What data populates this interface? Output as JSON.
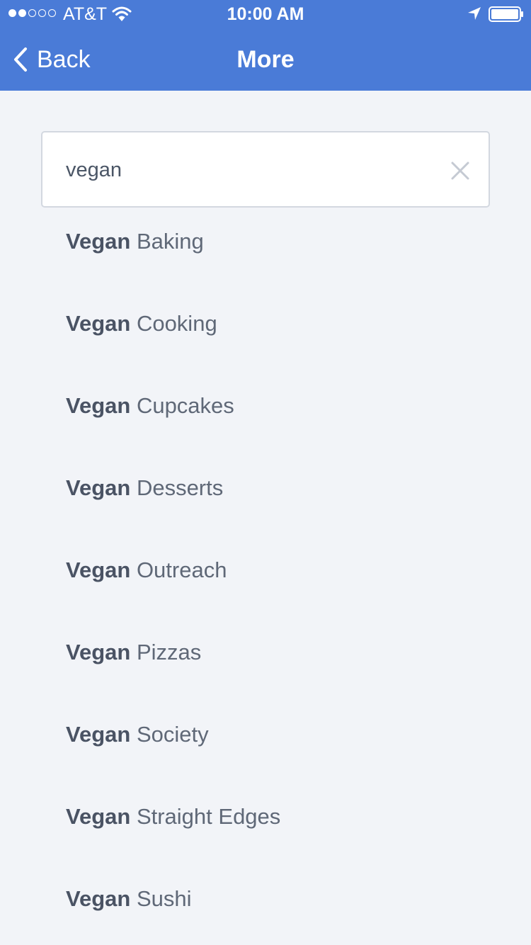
{
  "status_bar": {
    "signal_dots": [
      true,
      true,
      false,
      false,
      false
    ],
    "carrier": "AT&T",
    "time": "10:00 AM",
    "icons": [
      "wifi-icon",
      "location-arrow-icon",
      "battery-icon"
    ]
  },
  "nav": {
    "back_label": "Back",
    "title": "More",
    "background_color": "#4a7bd7"
  },
  "search": {
    "value": "vegan",
    "clear_icon": "close-icon"
  },
  "results": [
    {
      "match": "Vegan",
      "rest": " Baking"
    },
    {
      "match": "Vegan",
      "rest": " Cooking"
    },
    {
      "match": "Vegan",
      "rest": " Cupcakes"
    },
    {
      "match": "Vegan",
      "rest": " Desserts"
    },
    {
      "match": "Vegan",
      "rest": " Outreach"
    },
    {
      "match": "Vegan",
      "rest": " Pizzas"
    },
    {
      "match": "Vegan",
      "rest": " Society"
    },
    {
      "match": "Vegan",
      "rest": " Straight Edges"
    },
    {
      "match": "Vegan",
      "rest": " Sushi"
    }
  ]
}
